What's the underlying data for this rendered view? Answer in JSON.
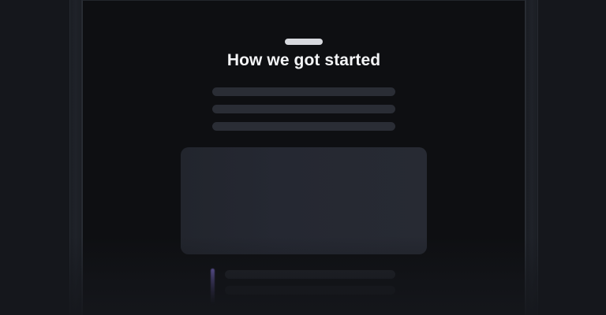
{
  "sheet": {
    "title": "How we got started"
  },
  "colors": {
    "background": "#15171c",
    "panel": "#0e0f12",
    "skeleton": "#2a2d35",
    "media_placeholder": "#252832",
    "accent": "#8c78e6",
    "handle": "#d7d9de"
  }
}
